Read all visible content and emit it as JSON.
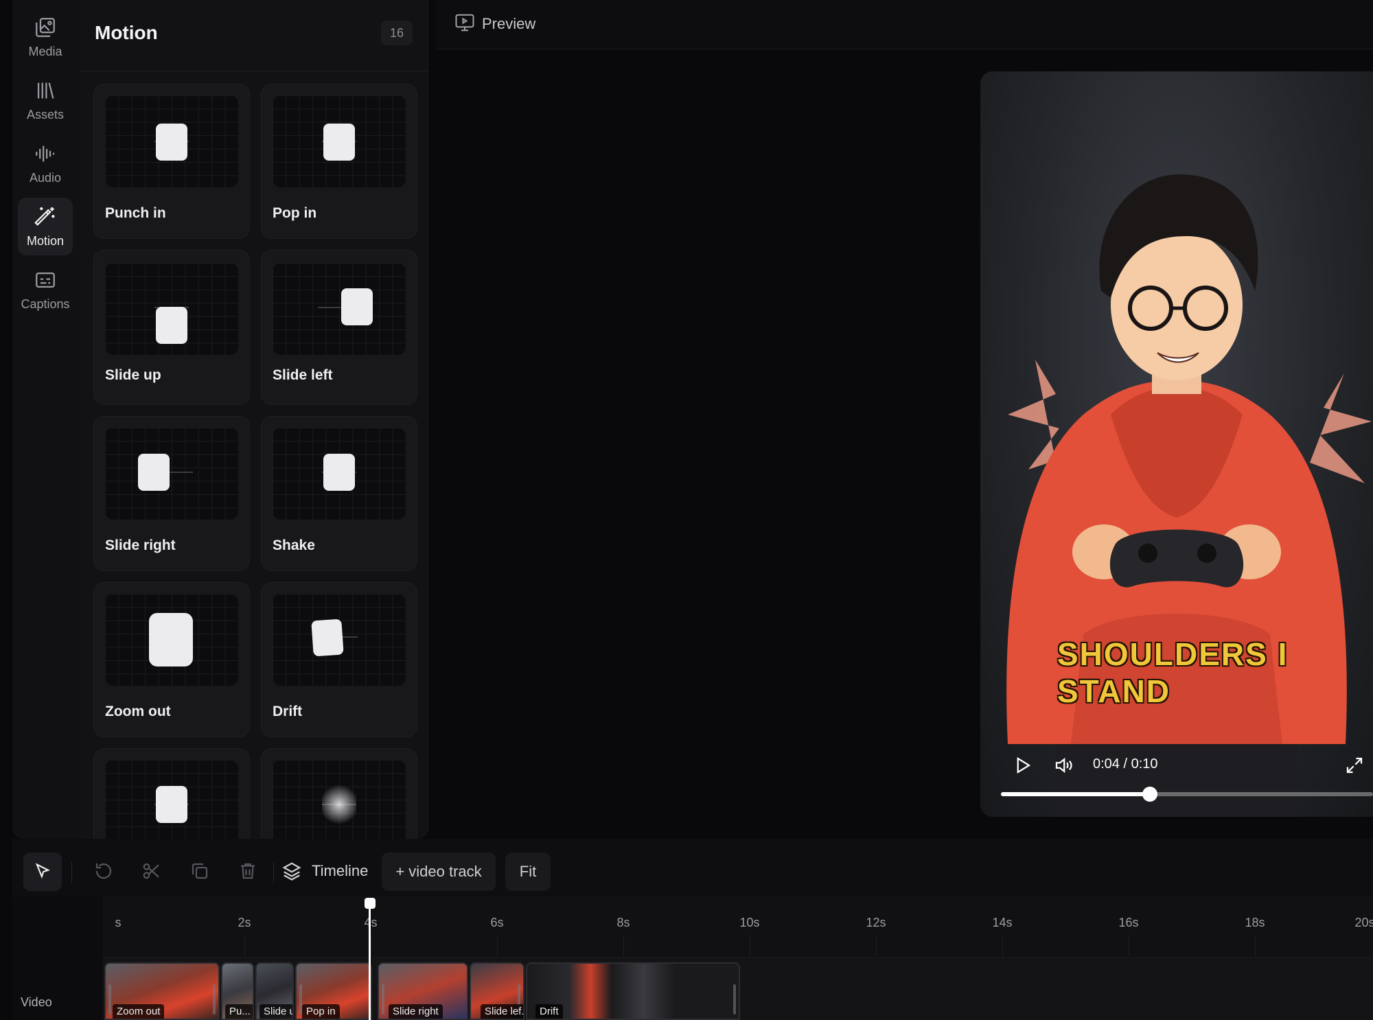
{
  "rail": {
    "items": [
      {
        "label": "Media",
        "icon": "media-icon"
      },
      {
        "label": "Assets",
        "icon": "library-icon"
      },
      {
        "label": "Audio",
        "icon": "waveform-icon"
      },
      {
        "label": "Motion",
        "icon": "magic-wand-icon",
        "active": true
      },
      {
        "label": "Captions",
        "icon": "captions-icon"
      }
    ]
  },
  "panel": {
    "title": "Motion",
    "count": "16",
    "cards": [
      {
        "label": "Punch in",
        "preview": "punch-in"
      },
      {
        "label": "Pop in",
        "preview": "pop-in"
      },
      {
        "label": "Slide up",
        "preview": "slide-up"
      },
      {
        "label": "Slide left",
        "preview": "slide-left"
      },
      {
        "label": "Slide right",
        "preview": "slide-right"
      },
      {
        "label": "Shake",
        "preview": "shake"
      },
      {
        "label": "Zoom out",
        "preview": "zoom-out"
      },
      {
        "label": "Drift",
        "preview": "drift"
      },
      {
        "label": "",
        "preview": "center"
      },
      {
        "label": "",
        "preview": "blur"
      }
    ]
  },
  "preview": {
    "label": "Preview",
    "caption": "SHOULDERS I STAND",
    "time": "0:04 / 0:10",
    "progress": 0.4
  },
  "toolbar": {
    "timeline_label": "Timeline",
    "add_track_label": "+ video track",
    "fit_label": "Fit"
  },
  "timeline": {
    "track_label": "Video",
    "ticks": [
      "s",
      "2s",
      "4s",
      "6s",
      "8s",
      "10s",
      "12s",
      "14s",
      "16s",
      "18s",
      "20s"
    ],
    "clips": [
      {
        "label": "Zoom out"
      },
      {
        "label": "Pu..."
      },
      {
        "label": "Slide u..."
      },
      {
        "label": "Pop in"
      },
      {
        "label": "Slide right"
      },
      {
        "label": "Slide lef..."
      },
      {
        "label": "Drift"
      }
    ]
  }
}
